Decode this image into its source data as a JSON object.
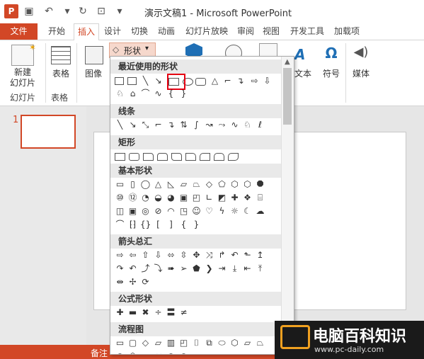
{
  "app": {
    "logo_text": "P",
    "title": "演示文稿1 - Microsoft PowerPoint"
  },
  "tabs": [
    "文件",
    "开始",
    "插入",
    "设计",
    "切换",
    "动画",
    "幻灯片放映",
    "审阅",
    "视图",
    "开发工具",
    "加载项"
  ],
  "ribbon": {
    "new_slide": "新建\n幻灯片",
    "slides_group": "幻灯片",
    "table": "表格",
    "table_group": "表格",
    "image": "图像",
    "shapes": "形状",
    "text": "文本",
    "symbol": "符号",
    "media": "媒体"
  },
  "slides": {
    "current_number": "1"
  },
  "statusbar": {
    "notes": "备注"
  },
  "gallery": {
    "sections": [
      "最近使用的形状",
      "线条",
      "矩形",
      "基本形状",
      "箭头总汇",
      "公式形状",
      "流程图"
    ]
  },
  "watermark": {
    "brand": "电脑百科知识",
    "url": "www.pc-daily.com"
  },
  "colors": {
    "accent": "#d24726",
    "highlight": "#e60012"
  }
}
